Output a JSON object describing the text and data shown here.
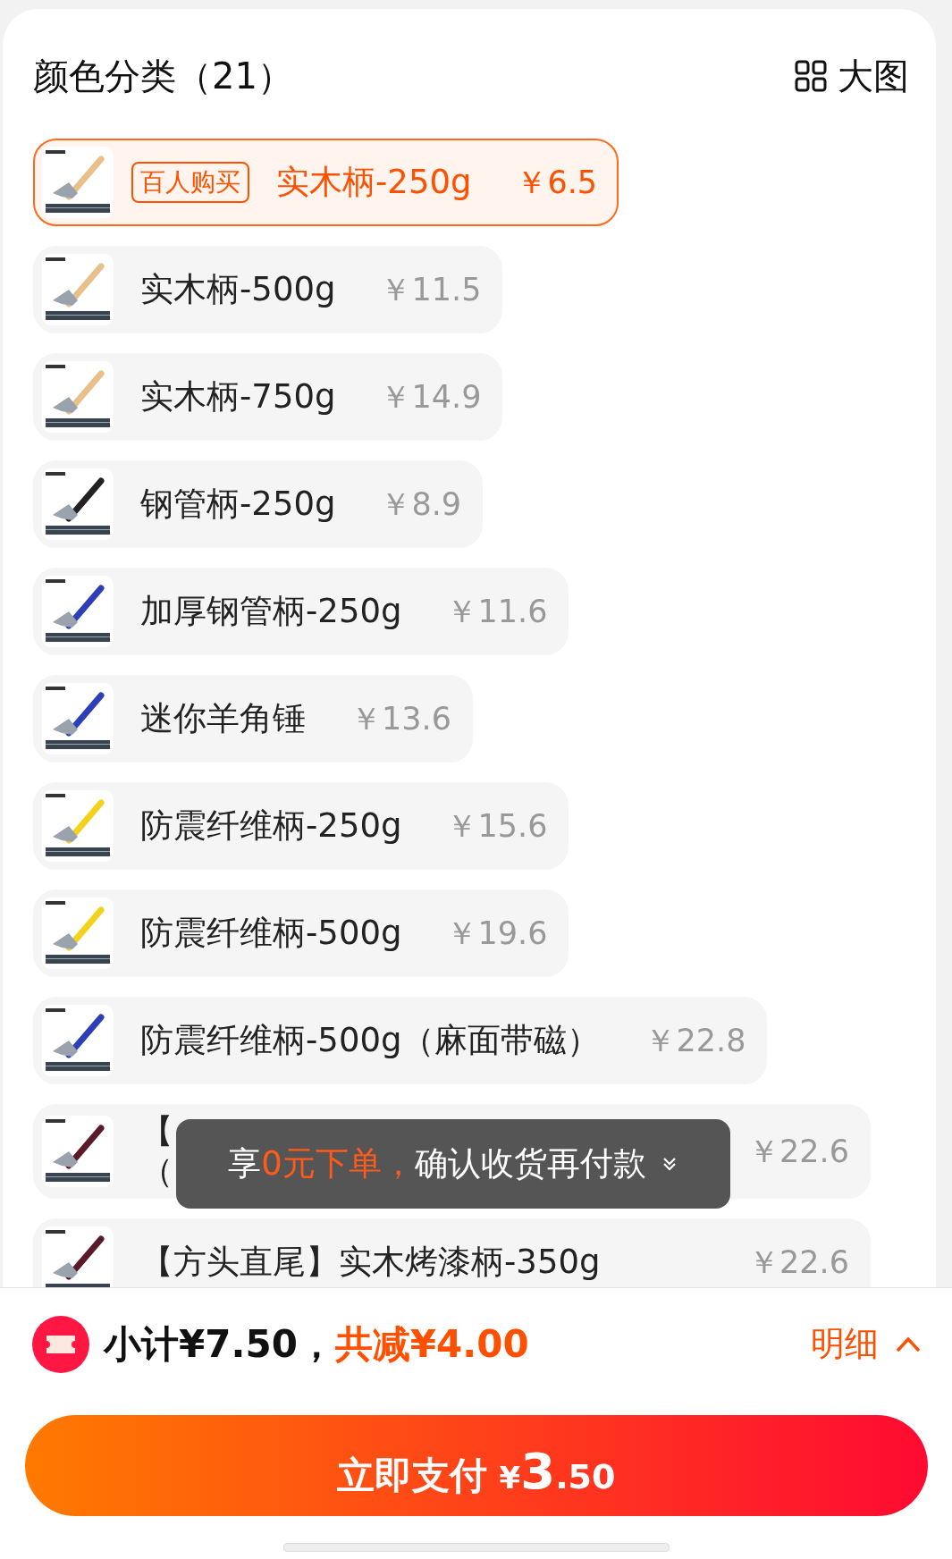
{
  "header": {
    "title": "颜色分类（21）",
    "view_toggle": "大图"
  },
  "variants": [
    {
      "name": "实木柄-250g",
      "price": "￥6.5",
      "badge": "百人购买",
      "selected": true
    },
    {
      "name": "实木柄-500g",
      "price": "￥11.5",
      "selected": false
    },
    {
      "name": "实木柄-750g",
      "price": "￥14.9",
      "selected": false
    },
    {
      "name": "钢管柄-250g",
      "price": "￥8.9",
      "selected": false
    },
    {
      "name": "加厚钢管柄-250g",
      "price": "￥11.6",
      "selected": false
    },
    {
      "name": "迷你羊角锤",
      "price": "￥13.6",
      "selected": false
    },
    {
      "name": "防震纤维柄-250g",
      "price": "￥15.6",
      "selected": false
    },
    {
      "name": "防震纤维柄-500g",
      "price": "￥19.6",
      "selected": false
    },
    {
      "name": "防震纤维柄-500g（麻面带磁）",
      "price": "￥22.8",
      "selected": false
    },
    {
      "name_lines": [
        "【",
        "（"
      ],
      "price": "￥22.6",
      "selected": false
    },
    {
      "name_lines": [
        "【方头直尾】实木烤漆柄-350g"
      ],
      "price": "￥22.6",
      "selected": false
    }
  ],
  "toast": {
    "segments": [
      {
        "text": "享",
        "highlight": false
      },
      {
        "text": "0元下单，",
        "highlight": true
      },
      {
        "text": "确认收货再付款",
        "highlight": false
      }
    ]
  },
  "summary": {
    "subtotal": "小计¥7.50，",
    "discount": "共减¥4.00",
    "details": "明细"
  },
  "pay_button": {
    "label": "立即支付",
    "currency": "¥",
    "integer": "3",
    "decimals": ".50"
  }
}
